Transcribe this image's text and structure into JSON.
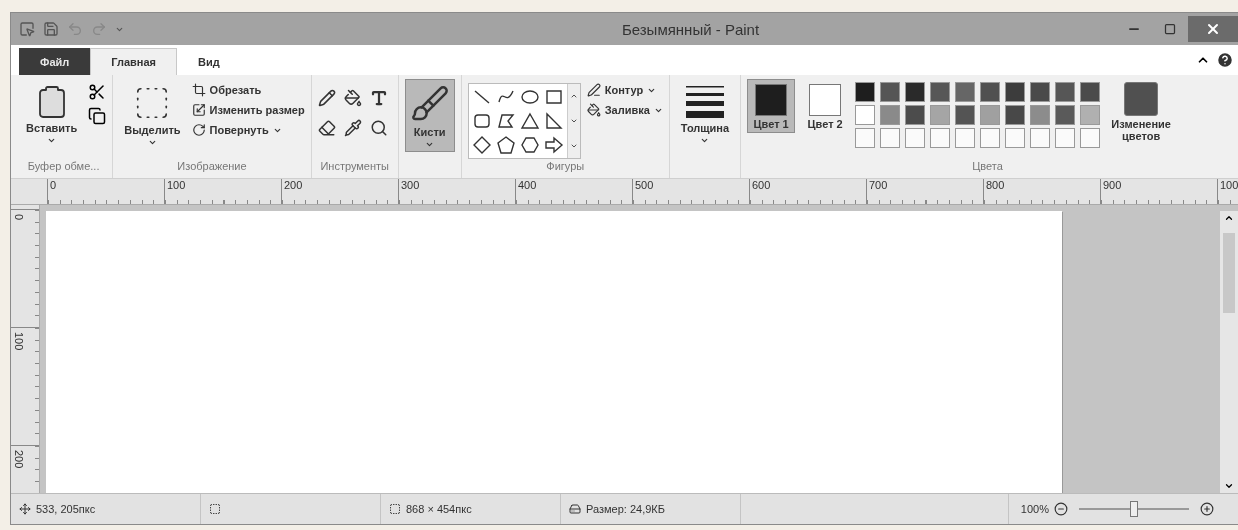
{
  "window": {
    "title": "Безымянный - Paint"
  },
  "tabs": [
    {
      "label": "Файл",
      "kind": "file",
      "selected": false
    },
    {
      "label": "Главная",
      "kind": "tab",
      "selected": true
    },
    {
      "label": "Вид",
      "kind": "tab",
      "selected": false
    }
  ],
  "ribbon": {
    "clipboard": {
      "label": "Буфер обме...",
      "paste": "Вставить"
    },
    "image": {
      "label": "Изображение",
      "select": "Выделить",
      "commands": [
        {
          "label": "Обрезать",
          "kind": "crop"
        },
        {
          "label": "Изменить размер",
          "kind": "resize"
        },
        {
          "label": "Повернуть",
          "kind": "rotate"
        }
      ]
    },
    "tools": {
      "label": "Инструменты"
    },
    "brushes": {
      "label": "Кисти",
      "selected": true
    },
    "shapes": {
      "label": "Фигуры",
      "outline": "Контур",
      "fill": "Заливка"
    },
    "size": {
      "label": "Толщина"
    },
    "colors": {
      "label": "Цвета",
      "swatches": [
        {
          "label": "Цвет 1",
          "color": "#1e1e1e",
          "selected": true
        },
        {
          "label": "Цвет 2",
          "color": "#ffffff",
          "selected": false
        }
      ],
      "palette": [
        [
          {
            "kind": "filled",
            "color": "#1e1e1e"
          },
          {
            "kind": "filled",
            "color": "#555555"
          },
          {
            "kind": "filled",
            "color": "#2a2a2a"
          },
          {
            "kind": "filled",
            "color": "#575757"
          },
          {
            "kind": "filled",
            "color": "#666666"
          },
          {
            "kind": "filled",
            "color": "#505050"
          },
          {
            "kind": "filled",
            "color": "#3c3c3c"
          },
          {
            "kind": "filled",
            "color": "#4a4a4a"
          },
          {
            "kind": "filled",
            "color": "#565656"
          },
          {
            "kind": "filled",
            "color": "#4b4b4b"
          }
        ],
        [
          {
            "kind": "filled",
            "color": "#ffffff"
          },
          {
            "kind": "filled",
            "color": "#8a8a8a"
          },
          {
            "kind": "filled",
            "color": "#4c4c4c"
          },
          {
            "kind": "filled",
            "color": "#a5a5a5"
          },
          {
            "kind": "filled",
            "color": "#545454"
          },
          {
            "kind": "filled",
            "color": "#a0a0a0"
          },
          {
            "kind": "filled",
            "color": "#484848"
          },
          {
            "kind": "filled",
            "color": "#8c8c8c"
          },
          {
            "kind": "filled",
            "color": "#5a5a5a"
          },
          {
            "kind": "filled",
            "color": "#b0b0b0"
          }
        ],
        [
          {
            "kind": "empty"
          },
          {
            "kind": "empty"
          },
          {
            "kind": "empty"
          },
          {
            "kind": "empty"
          },
          {
            "kind": "empty"
          },
          {
            "kind": "empty"
          },
          {
            "kind": "empty"
          },
          {
            "kind": "empty"
          },
          {
            "kind": "empty"
          },
          {
            "kind": "empty"
          }
        ]
      ],
      "edit": "Изменение цветов"
    }
  },
  "rulers": {
    "horizontal": [
      "0",
      "100",
      "200",
      "300",
      "400",
      "500",
      "600",
      "700",
      "800",
      "900",
      "100"
    ],
    "vertical": [
      "0",
      "100",
      "200"
    ]
  },
  "status_bar": {
    "cursor": "533, 205пкс",
    "canvas_size": "868 × 454пкс",
    "file_size": "Размер: 24,9КБ",
    "zoom": {
      "reading": "100%",
      "level": 0.5
    }
  }
}
